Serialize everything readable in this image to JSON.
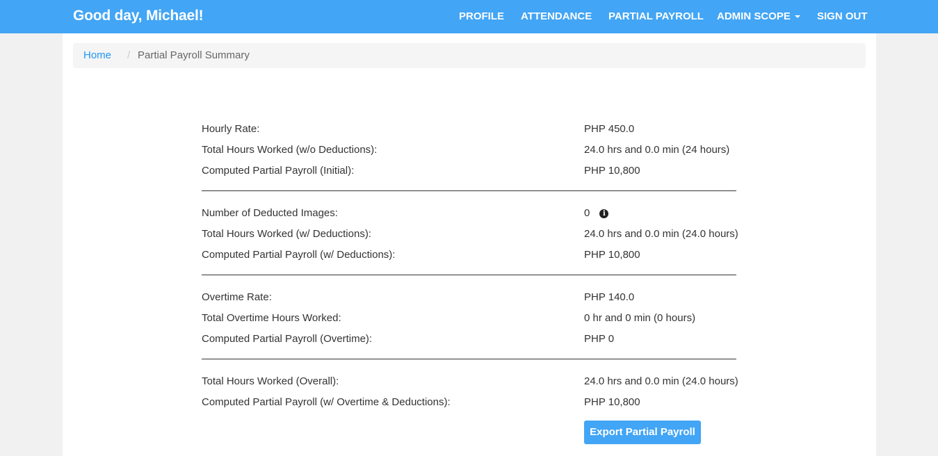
{
  "navbar": {
    "greeting": "Good day, Michael!",
    "links": {
      "profile": "PROFILE",
      "attendance": "ATTENDANCE",
      "partial_payroll": "PARTIAL PAYROLL",
      "admin_scope": "ADMIN SCOPE",
      "sign_out": "SIGN OUT"
    }
  },
  "breadcrumb": {
    "home": "Home",
    "separator": "/",
    "current": "Partial Payroll Summary"
  },
  "summary": {
    "hourly_rate": {
      "label": "Hourly Rate:",
      "value": "PHP 450.0"
    },
    "hours_no_deductions": {
      "label": "Total Hours Worked (w/o Deductions):",
      "value": "24.0 hrs and 0.0 min (24 hours)"
    },
    "payroll_initial": {
      "label": "Computed Partial Payroll (Initial):",
      "value": "PHP 10,800"
    },
    "deducted_images": {
      "label": "Number of Deducted Images:",
      "value": "0"
    },
    "hours_with_deductions": {
      "label": "Total Hours Worked (w/ Deductions):",
      "value": "24.0 hrs and 0.0 min (24.0 hours)"
    },
    "payroll_with_deductions": {
      "label": "Computed Partial Payroll (w/ Deductions):",
      "value": "PHP 10,800"
    },
    "overtime_rate": {
      "label": "Overtime Rate:",
      "value": "PHP 140.0"
    },
    "overtime_hours": {
      "label": "Total Overtime Hours Worked:",
      "value": "0 hr and 0 min (0 hours)"
    },
    "payroll_overtime": {
      "label": "Computed Partial Payroll (Overtime):",
      "value": "PHP 0"
    },
    "hours_overall": {
      "label": "Total Hours Worked (Overall):",
      "value": "24.0 hrs and 0.0 min (24.0 hours)"
    },
    "payroll_overall": {
      "label": "Computed Partial Payroll (w/ Overtime & Deductions):",
      "value": "PHP 10,800"
    }
  },
  "icons": {
    "info": "info-circle-icon",
    "caret": "caret-down-icon"
  },
  "export_button": "Export Partial Payroll",
  "colors": {
    "primary": "#42a5f5",
    "link": "#2196f3",
    "background": "#f1f1f1"
  }
}
